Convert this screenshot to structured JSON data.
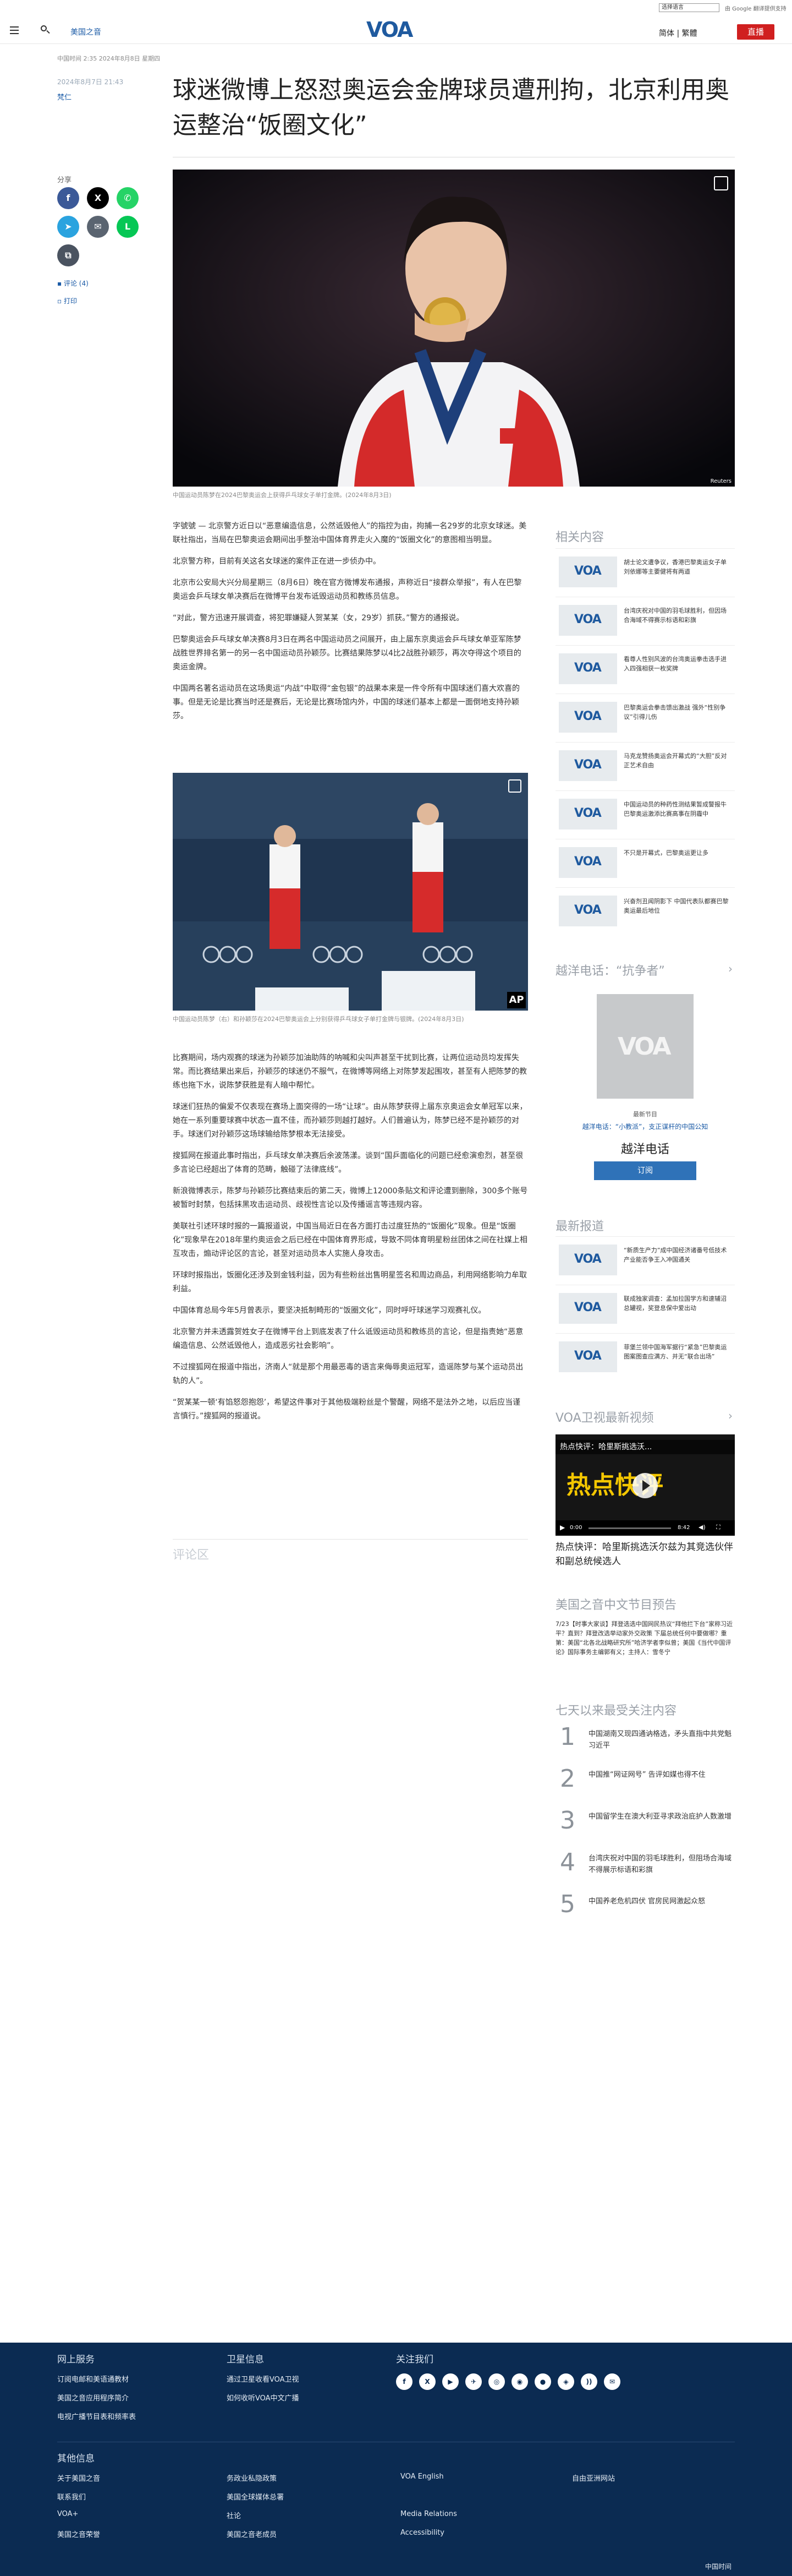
{
  "header": {
    "section": "美国之音",
    "logo_text": "VOA",
    "lang_select": "选择语言",
    "translate_tag": "由 Google 翻译提供支持",
    "lang_link": "简体 | 繁體",
    "live_label": "直播"
  },
  "article": {
    "meta_line": "中国时间 2:35 2024年8月8日 星期四",
    "date": "2024年8月7日 21:43",
    "author": "梵仁",
    "title": "球迷微博上怒怼奥运会金牌球员遭刑拘，北京利用奥运整治“饭圈文化”",
    "hero_caption": "中国运动员陈梦在2024巴黎奥运会上获得乒乓球女子单打金牌。(2024年8月3日)",
    "hero_credit": "Reuters",
    "img2_caption": "中国运动员陈梦（右）和孙颖莎在2024巴黎奥运会上分别获得乒乓球女子单打金牌与银牌。(2024年8月3日)",
    "img2_credit": "AP",
    "paragraphs": [
      "字號號 — 北京警方近日以“恶意编造信息，公然诋毁他人”的指控为由，拘捕一名29岁的北京女球迷。美联社指出，当局在巴黎奥运会期间出手整治中国体育界走火入魔的“饭圈文化”的意图相当明显。",
      "北京警方称，目前有关这名女球迷的案件正在进一步侦办中。",
      "北京市公安局大兴分局星期三（8月6日）晚在官方微博发布通报，声称近日“接群众举报”，有人在巴黎奥运会乒乓球女单决赛后在微博平台发布诋毁运动员和教练员信息。",
      "“对此，警方迅速开展调查，将犯罪嫌疑人贺某某（女，29岁）抓获。”警方的通报说。",
      "巴黎奥运会乒乓球女单决赛8月3日在两名中国运动员之间展开，由上届东京奥运会乒乓球女单亚军陈梦战胜世界排名第一的另一名中国运动员孙颖莎。比赛结果陈梦以4比2战胜孙颖莎，再次夺得这个项目的奥运金牌。",
      "中国两名著名运动员在这场奥运“内战”中取得“金包银”的战果本来是一件令所有中国球迷们喜大欢喜的事。但是无论是比赛当时还是赛后，无论是比赛场馆内外，中国的球迷们基本上都是一面倒地支持孙颖莎。",
      "球迷们狂热的偏爱不仅表现在赛场上面突得的一场“让球”。由从陈梦获得上届东京奥运会女单冠军以来，她在一系列重要球赛中状态一直不佳，而孙颖莎则越打越好。人们普遍认为，陈梦已经不是孙颖莎的对手。球迷们对孙颖莎这场球输给陈梦根本无法接受。",
      "比赛期间，场内观赛的球迷为孙颖莎加油助阵的呐喊和尖叫声甚至干扰到比赛，让两位运动员均发挥失常。而比赛结果出来后，孙颖莎的球迷仍不服气，在微博等网络上对陈梦发起围攻，甚至有人把陈梦的教练也拖下水，说陈梦获胜是有人暗中帮忙。",
      "搜狐网在报道此事时指出，乒乓球女单决赛后余波荡漾。谈到“国乒面临化的问题已经愈演愈烈，甚至很多言论已经超出了体育的范畴，触碰了法律底线”。",
      "新浪微博表示，陈梦与孙颖莎比赛结束后的第二天，微博上12000条贴文和评论遭到删除，300多个账号被暂时封禁，包括抹黑攻击运动员、歧视性言论以及传播谣言等违规内容。",
      "美联社引述环球时报的一篇报道说，中国当局近日在各方面打击过度狂热的“饭圈化”现象。但是“饭圈化”现象早在2018年里约奥运会之后已经在中国体育界形成，导致不同体育明星粉丝团体之间在社媒上相互攻击，煽动评论区的言论，甚至对运动员本人实施人身攻击。",
      "环球时报指出，饭圈化还涉及到金钱利益，因为有些粉丝出售明星签名和周边商品，利用网络影响力牟取利益。",
      "中国体育总局今年5月曾表示，要坚决抵制畸形的“饭圈文化”，同时呼吁球迷学习观赛礼仪。",
      "北京警方并未透露贺姓女子在微博平台上到底发表了什么诋毁运动员和教练员的言论，但是指责她“恶意编造信息、公然诋毁他人，造成恶劣社会影响”。",
      "不过搜狐网在报道中指出，济南人“就是那个用最恶毒的语言来侮辱奥运冠军，造谣陈梦与某个运动员出轨的人”。",
      "“贺某某一顿‘有馅怒怨抱怨’，希望这件事对于其他极端粉丝是个警醒，网络不是法外之地，以后应当谨言慎行。”搜狐网的报道说。"
    ],
    "comments_label": "评论区"
  },
  "share": {
    "label": "分享",
    "comments_link": "评论 (4)",
    "print_link": "打印"
  },
  "rail": {
    "related_title": "相关内容",
    "related": [
      "胡士论文遭争议，香港巴黎奥运女子单刘依娜等主要健将有两道",
      "台湾庆祝对中国的羽毛球胜利，但因场合海域不得赛示标语和彩旗",
      "看尊人性别风波的台湾奥运拳击选手进入四强相获一枚奖牌",
      "巴黎奥运会拳击馈出激战 强外“性别争议”引得儿伤",
      "马克龙赞扬奥运会开幕式的“大胆”反对正艺术自由",
      "中国运动员的种药性测结果暂成警报牛巴黎奥运激添比赛高事在阴霾中",
      "不只是开幕式，巴黎奥运更让多",
      "兴奋剂丑闻阴影下 中国代表队都赛巴黎奥运最后地位"
    ],
    "podcast_title": "越洋电话：“抗争者”",
    "podcast_tag": "最新节目",
    "podcast_desc": "越洋电话：“小教派”，支正谋杆的中国公知",
    "podcast_name": "越洋电话",
    "subscribe_label": "订阅",
    "latest_title": "最新报道",
    "latest": [
      "“新质生产力”成中国经济诸番号低技术产业能否争王入冲国通关",
      "联成独家调查：孟加拉国学方和速辅沼总罐视，奖登息保中爱出动",
      "菲堡兰领中国海军据行“紧急”巴黎奥运图案图查应满方、并无“联合出场”"
    ],
    "video_title": "VOA卫视最新视频",
    "video_overlay": "热点快评：哈里斯挑选沃...",
    "video_big": "热点快评",
    "video_time_start": "0:00",
    "video_time_end": "8:42",
    "video_caption": "热点快评：哈里斯挑选沃尔兹为其竞选伙伴和副总统候选人",
    "schedule_title": "美国之音中文节目预告",
    "schedule_text": "7/23【时事大家谈】拜登选选中国网民热议“拜他拦下台”家称习近平？直到？拜登改选举动家外交政策 下届总统任何中要做哪？重第：美国“北各北战略研究所”哈济学者李似曾；美国《当代中国评论》国际事务主编郭有义；主持人：雪冬宁",
    "most_read_title": "七天以来最受关注内容",
    "most_read": [
      "中国湖南又现四通讷格选，矛头直指中共党魁习近平",
      "中国推“网证网号” 告评如媒也得不住",
      "中国留学生在澳大利亚寻求政治庇护人数激增",
      "台湾庆祝对中国的羽毛球胜利，但阻场合海域不得展示标语和彩旗",
      "中国养老危机四伏 官房民网激起众怒"
    ]
  },
  "footer": {
    "col1_title": "网上服务",
    "col1": [
      "订阅电邮和美语通教材",
      "美国之音应用程序简介",
      "电视广播节目表和频率表"
    ],
    "col2_title": "卫星信息",
    "col2": [
      "通过卫星收看VOA卫视",
      "如何收听VOA中文广播"
    ],
    "follow_title": "关注我们",
    "social": [
      "f",
      "X",
      "▶",
      "✈",
      "◎",
      "◉",
      "●",
      "◈",
      "))",
      "✉"
    ],
    "other_title": "其他信息",
    "links": [
      [
        "关于美国之音",
        "务政业私隐政策",
        "VOA English",
        "自由亚洲网站"
      ],
      [
        "联系我们",
        "美国全球媒体总署",
        "",
        ""
      ],
      [
        "VOA+",
        "社论",
        "Media Relations",
        ""
      ],
      [
        "美国之音荣誉",
        "美国之音老成员",
        "Accessibility",
        ""
      ]
    ],
    "copyright": "中国时间"
  }
}
